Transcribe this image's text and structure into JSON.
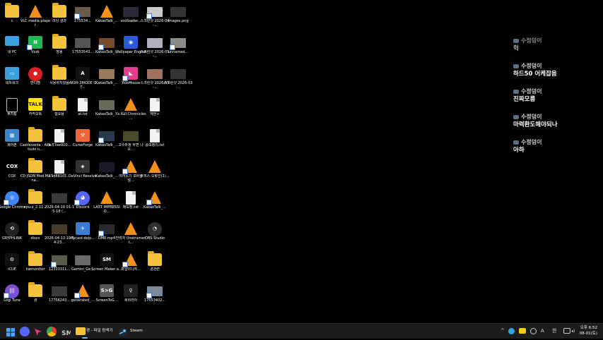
{
  "desktop": {
    "icons": [
      {
        "label": "c",
        "kind": "folder"
      },
      {
        "label": "VLC media player",
        "kind": "cone"
      },
      {
        "label": "러닝 결과",
        "kind": "folder"
      },
      {
        "label": "175534...",
        "kind": "thumb",
        "color": "#6b5a4a"
      },
      {
        "label": "KakaoTalk_...",
        "kind": "cone"
      },
      {
        "label": "vodloader...",
        "kind": "thumb",
        "color": "#2a2a3a"
      },
      {
        "label": "스크린샷 2026-04-...",
        "kind": "thumb",
        "color": "#c8c8c8"
      },
      {
        "label": "images.png",
        "kind": "thumb",
        "color": "#333"
      },
      {
        "label": "내 PC",
        "kind": "pc"
      },
      {
        "label": "Vzzk",
        "kind": "app",
        "color": "#1db954",
        "glyph": "N"
      },
      {
        "label": "방송",
        "kind": "folder"
      },
      {
        "label": "17553543...",
        "kind": "thumb",
        "color": "#555"
      },
      {
        "label": "KakaoTalk_...",
        "kind": "thumb",
        "color": "#7a4a2a"
      },
      {
        "label": "Wallpaper Engine",
        "kind": "app",
        "color": "#2d5bd7",
        "glyph": "◉"
      },
      {
        "label": "스크린샷 2026-05-...",
        "kind": "thumb",
        "color": "#b0b0c0"
      },
      {
        "label": "unnamed...",
        "kind": "thumb",
        "color": "#8a8a8a"
      },
      {
        "label": "네트워크",
        "kind": "app",
        "color": "#3ba0e0",
        "glyph": "▭"
      },
      {
        "label": "반디캠",
        "kind": "circle",
        "color": "#d81f26",
        "glyph": "●"
      },
      {
        "label": "사용하지않음",
        "kind": "folder"
      },
      {
        "label": "AK99 3MODE OT...",
        "kind": "app",
        "color": "#111",
        "glyph": "A"
      },
      {
        "label": "KakaoTalk_...",
        "kind": "thumb",
        "color": "#9a7a5a"
      },
      {
        "label": "YoloMouse",
        "kind": "app",
        "color": "#e23c8a",
        "glyph": "◣"
      },
      {
        "label": "스크린샷 2026-05-...",
        "kind": "thumb",
        "color": "#a07060"
      },
      {
        "label": "스크린샷 2026-03-...",
        "kind": "thumb",
        "color": "#333"
      },
      {
        "label": "휴지통",
        "kind": "bin"
      },
      {
        "label": "카카오톡",
        "kind": "app",
        "color": "#fae100",
        "glyph": "TALK"
      },
      {
        "label": "합요용",
        "kind": "folder"
      },
      {
        "label": "at.txt",
        "kind": "doc"
      },
      {
        "label": "KakaoTalk_...",
        "kind": "thumb",
        "color": "#6a6a5a"
      },
      {
        "label": "Ys I&II Chronicles ...",
        "kind": "cone"
      },
      {
        "label": "제헌+",
        "kind": "doc"
      },
      {
        "label": "",
        "kind": "none"
      },
      {
        "label": "제어판",
        "kind": "app",
        "color": "#3b86c6",
        "glyph": "▦"
      },
      {
        "label": "Castlevania - Akatsuki n...",
        "kind": "folder"
      },
      {
        "label": "3c57ee910...",
        "kind": "doc"
      },
      {
        "label": "CurseForge",
        "kind": "app",
        "color": "#f16436",
        "glyph": "⚒"
      },
      {
        "label": "KakaoTalk_...",
        "kind": "thumb",
        "color": "#2a3a4a"
      },
      {
        "label": "고수투정 하면 나오...",
        "kind": "thumb",
        "color": "#4a4a2a"
      },
      {
        "label": "증보정리.txt",
        "kind": "doc"
      },
      {
        "label": "",
        "kind": "none"
      },
      {
        "label": "COX",
        "kind": "app",
        "color": "#000",
        "glyph": "COX"
      },
      {
        "label": "CD JSON Mod Mana...",
        "kind": "folder"
      },
      {
        "label": "19d88101...",
        "kind": "doc"
      },
      {
        "label": "DaVinci Resolve",
        "kind": "app",
        "color": "#333",
        "glyph": "◈"
      },
      {
        "label": "KakaoTalk_...",
        "kind": "thumb",
        "color": "#1a1a2a"
      },
      {
        "label": "여러노기 모바일 설...",
        "kind": "cone"
      },
      {
        "label": "쿠피스 오랑선(1)...",
        "kind": "cone"
      },
      {
        "label": "",
        "kind": "none"
      },
      {
        "label": "Google Chrome",
        "kind": "circle",
        "color": "#4285f4",
        "glyph": "◎"
      },
      {
        "label": "cpu-z_2.11...",
        "kind": "folder"
      },
      {
        "label": "2026-04-10 01-15-18 (...",
        "kind": "thumb",
        "color": "#3a3a3a"
      },
      {
        "label": "Discord",
        "kind": "circle",
        "color": "#5865f2",
        "glyph": "◕"
      },
      {
        "label": "LAST IMPRESSIO...",
        "kind": "cone"
      },
      {
        "label": "메모장.txt",
        "kind": "doc"
      },
      {
        "label": "KakaoTalk_...",
        "kind": "cone"
      },
      {
        "label": "",
        "kind": "none"
      },
      {
        "label": "GRYPHLINK",
        "kind": "circle",
        "color": "#222",
        "glyph": "⟲"
      },
      {
        "label": "disco",
        "kind": "folder"
      },
      {
        "label": "2026-04-13 19-54-23...",
        "kind": "thumb",
        "color": "#4a3a2a"
      },
      {
        "label": "flycast-dojo...",
        "kind": "app",
        "color": "#3a7bd5",
        "glyph": "✈"
      },
      {
        "label": "DMR.mp4",
        "kind": "thumb",
        "color": "#2a2a2a"
      },
      {
        "label": "전력자 (Instrument...",
        "kind": "cone"
      },
      {
        "label": "OBS Studio",
        "kind": "circle",
        "color": "#302e31",
        "glyph": "◔"
      },
      {
        "label": "",
        "kind": "none"
      },
      {
        "label": "iCUE",
        "kind": "app",
        "color": "#111",
        "glyph": "⚙"
      },
      {
        "label": "hwmonitor",
        "kind": "folder"
      },
      {
        "label": "12333311...",
        "kind": "thumb",
        "color": "#5a5a4a"
      },
      {
        "label": "Gemini_Ge...",
        "kind": "thumb",
        "color": "#6a6a6a"
      },
      {
        "label": "Screen Maker a...",
        "kind": "app",
        "color": "#111",
        "glyph": "SM"
      },
      {
        "label": "파일이나자...",
        "kind": "cone"
      },
      {
        "label": "경관련",
        "kind": "folder"
      },
      {
        "label": "",
        "kind": "none"
      },
      {
        "label": "Logi Tune",
        "kind": "circle",
        "color": "#7b4fd6",
        "glyph": "|||"
      },
      {
        "label": "경",
        "kind": "folder"
      },
      {
        "label": "17756243...",
        "kind": "thumb",
        "color": "#3a3a3a"
      },
      {
        "label": "generated_...",
        "kind": "cone"
      },
      {
        "label": "ScreenToG...",
        "kind": "app",
        "color": "#555",
        "glyph": "S>G"
      },
      {
        "label": "세위라아",
        "kind": "app",
        "color": "#222",
        "glyph": "♀"
      },
      {
        "label": "17553402...",
        "kind": "thumb",
        "color": "#7a8a9a"
      },
      {
        "label": "",
        "kind": "none"
      }
    ]
  },
  "chat": {
    "messages": [
      {
        "user": "수정덩이",
        "text": "헉"
      },
      {
        "user": "수정덩이",
        "text": "하드50 어케잡음"
      },
      {
        "user": "수정덩이",
        "text": "진짜모름"
      },
      {
        "user": "수정덩이",
        "text": "마력환도해야되나"
      },
      {
        "user": "수정덩이",
        "text": "아하"
      }
    ]
  },
  "taskbar": {
    "apps": [
      {
        "name": "windows-start",
        "color": "#4aa3ff"
      },
      {
        "name": "discord",
        "color": "#5865f2"
      },
      {
        "name": "yolomouse",
        "color": "#e23c8a"
      },
      {
        "name": "chrome",
        "color": "#4285f4"
      },
      {
        "name": "screen-maker",
        "color": "#888"
      }
    ],
    "explorer_label": "경 - 파일 탐색기",
    "steam_label": "Steam",
    "tray": {
      "chevron": "^",
      "ime1": "A",
      "ime2": "한",
      "time": "오후 6:52",
      "date": "08-01(토)"
    }
  }
}
